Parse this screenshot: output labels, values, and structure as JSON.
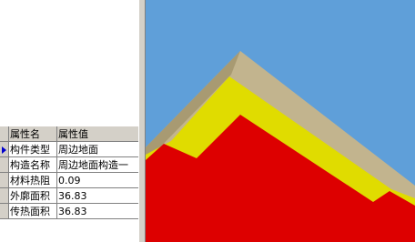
{
  "property_grid": {
    "headers": [
      "属性名",
      "属性值"
    ],
    "rows": [
      {
        "name": "构件类型",
        "value": "周边地面",
        "current": true
      },
      {
        "name": "构造名称",
        "value": "周边地面构造一",
        "current": false
      },
      {
        "name": "材料热阻",
        "value": "0.09",
        "current": false
      },
      {
        "name": "外廓面积",
        "value": "36.83",
        "current": false
      },
      {
        "name": "传热面积",
        "value": "36.83",
        "current": false
      }
    ]
  },
  "viewport": {
    "colors": {
      "sky": "#5f9fd9",
      "roof_edge": "#c2b48e",
      "roof_edge_shade": "#a89a72",
      "yellow_layer": "#e0dc00",
      "red_body": "#dd0000"
    }
  }
}
